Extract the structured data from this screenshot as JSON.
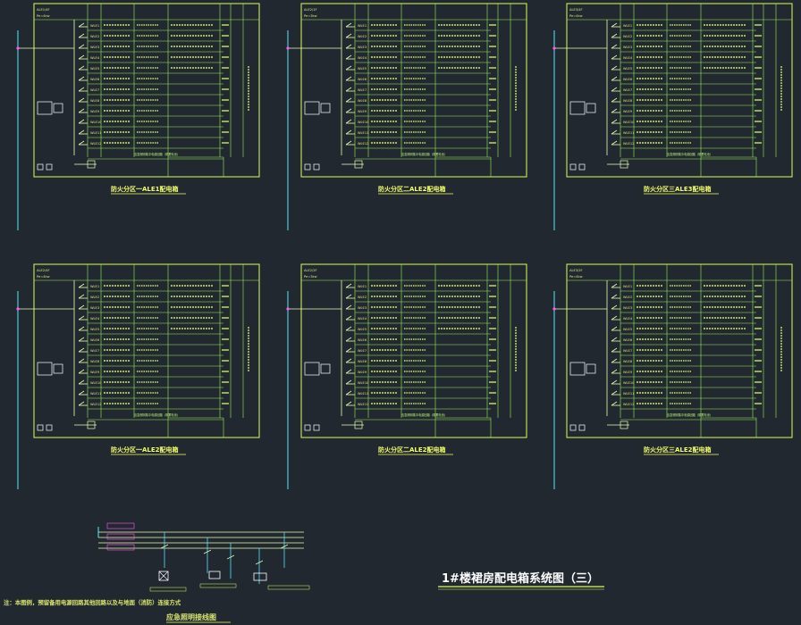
{
  "drawing": {
    "main_title": "1#楼裙房配电箱系统图（三）",
    "note": "注：本图例，预留备用电源回路其他回路以及与地面（消防）连接方式",
    "legend_title": "应急照明接线图"
  },
  "colors": {
    "background": "#212830",
    "frame": "#d9ff5c",
    "grid": "#9cf05a",
    "text": "#dfe87a",
    "cyan": "#4fe7ff",
    "magenta": "#ff5cf0",
    "title": "#ffffff"
  },
  "panels": [
    {
      "caption": "防火分区一ALE1配电箱",
      "header_left": "ALE1/4F",
      "header_left2": "Pe=4kw",
      "feeder_label": "",
      "circuits": [
        "WLE1",
        "WLE2",
        "WLE3",
        "WLE4",
        "WLE5",
        "WLE6",
        "WLE7",
        "WLE8",
        "WLE9",
        "WLE10",
        "WLE11",
        "WLE12"
      ],
      "note_row": "应急照明集中电源回路（带蓄电池）"
    },
    {
      "caption": "防火分区二ALE2配电箱",
      "header_left": "ALE2/1F",
      "header_left2": "Pe=3kw",
      "feeder_label": "",
      "circuits": [
        "WLE1",
        "WLE2",
        "WLE3",
        "WLE4",
        "WLE5",
        "WLE6",
        "WLE7",
        "WLE8",
        "WLE9",
        "WLE10",
        "WLE11",
        "WLE12"
      ],
      "note_row": "应急照明集中电源回路（带蓄电池）"
    },
    {
      "caption": "防火分区三ALE3配电箱",
      "header_left": "ALE3/4F",
      "header_left2": "Pe=4kw",
      "feeder_label": "",
      "circuits": [
        "WLE1",
        "WLE2",
        "WLE3",
        "WLE4",
        "WLE5",
        "WLE6",
        "WLE7",
        "WLE8",
        "WLE9",
        "WLE10",
        "WLE11",
        "WLE12"
      ],
      "note_row": "应急照明集中电源回路（带蓄电池）"
    },
    {
      "caption": "防火分区一ALE2配电箱",
      "header_left": "ALE2/4F",
      "header_left2": "Pe=4kw",
      "feeder_label": "",
      "circuits": [
        "WLE1",
        "WLE2",
        "WLE3",
        "WLE4",
        "WLE5",
        "WLE6",
        "WLE7",
        "WLE8",
        "WLE9",
        "WLE10",
        "WLE11",
        "WLE12"
      ],
      "note_row": "应急照明集中电源回路（带蓄电池）"
    },
    {
      "caption": "防火分区二ALE2配电箱",
      "header_left": "ALE2/2F",
      "header_left2": "Pe=3kw",
      "feeder_label": "",
      "circuits": [
        "WLE1",
        "WLE2",
        "WLE3",
        "WLE4",
        "WLE5",
        "WLE6",
        "WLE7",
        "WLE8",
        "WLE9",
        "WLE10",
        "WLE11",
        "WLE12"
      ],
      "note_row": "应急照明集中电源回路（带蓄电池）"
    },
    {
      "caption": "防火分区三ALE2配电箱",
      "header_left": "ALE3/2F",
      "header_left2": "Pe=4kw",
      "feeder_label": "",
      "circuits": [
        "WLE1",
        "WLE2",
        "WLE3",
        "WLE4",
        "WLE5",
        "WLE6",
        "WLE7",
        "WLE8",
        "WLE9",
        "WLE10",
        "WLE11",
        "WLE12"
      ],
      "note_row": "应急照明集中电源回路（带蓄电池）"
    }
  ]
}
